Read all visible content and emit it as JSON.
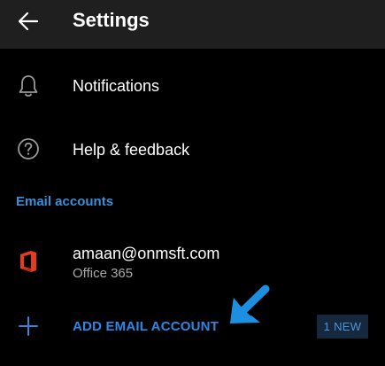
{
  "appbar": {
    "title": "Settings",
    "back_icon": "arrow-left-icon"
  },
  "items": [
    {
      "label": "Notifications",
      "icon": "bell-icon"
    },
    {
      "label": "Help & feedback",
      "icon": "question-circle-icon"
    }
  ],
  "email_accounts": {
    "header": "Email accounts",
    "accounts": [
      {
        "email": "amaan@onmsft.com",
        "type": "Office 365",
        "icon": "office-logo-icon"
      }
    ],
    "add_label": "ADD EMAIL ACCOUNT",
    "add_icon": "plus-icon",
    "badge": "1 NEW"
  },
  "colors": {
    "background": "#000000",
    "appbar": "#1f1f1f",
    "accent": "#2f87e4",
    "office_red": "#e63b1e",
    "annotation": "#1c8fe0"
  }
}
